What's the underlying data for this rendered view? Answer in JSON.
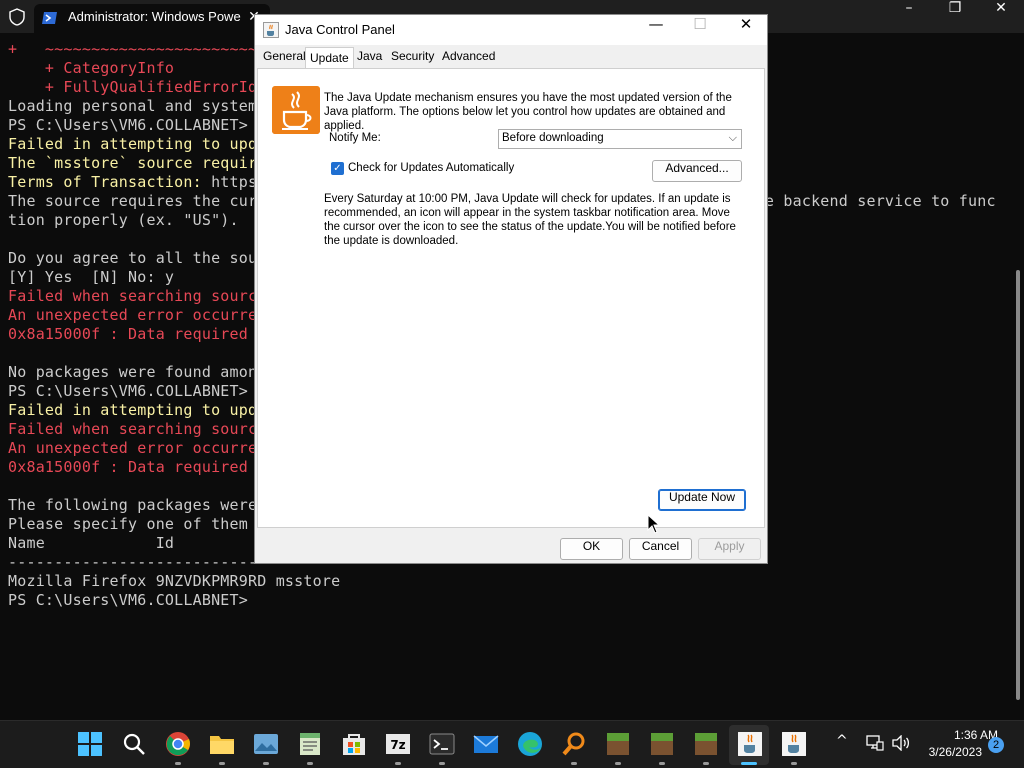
{
  "terminal": {
    "tab_title": "Administrator: Windows Powe",
    "icons": {
      "shield": "shield-icon",
      "powershell": "powershell-icon",
      "close": "close-icon"
    },
    "window_controls": {
      "minimize": "–",
      "maximize": "❐",
      "close": "✕"
    },
    "lines": [
      [
        [
          "+   ~~~~~~~~~~~~~~~~~~~~~~~~~~~~~~~~~~~~~~",
          "r"
        ]
      ],
      [
        [
          "    + CategoryInfo",
          "r"
        ]
      ],
      [
        [
          "    + FullyQualifiedErrorId",
          "r"
        ]
      ],
      [
        [
          "Loading personal and system",
          "w"
        ]
      ],
      [
        [
          "PS C:\\Users\\VM6.COLLABNET> ",
          "w"
        ],
        [
          "w",
          "y"
        ]
      ],
      [
        [
          "Failed in attempting to upda",
          "y"
        ]
      ],
      [
        [
          "The `msstore` source require",
          "y"
        ]
      ],
      [
        [
          "Terms of Transaction: ",
          "y"
        ],
        [
          "https",
          "w"
        ]
      ],
      [
        [
          "The source requires the curr                                                     he backend service to func",
          "w"
        ]
      ],
      [
        [
          "tion properly (ex. \"US\").",
          "w"
        ]
      ],
      [
        [
          "",
          "w"
        ]
      ],
      [
        [
          "Do you agree to all the sour",
          "w"
        ]
      ],
      [
        [
          "[Y] Yes  [N] No: y",
          "w"
        ]
      ],
      [
        [
          "Failed when searching source",
          "r"
        ]
      ],
      [
        [
          "An unexpected error occurred",
          "r"
        ]
      ],
      [
        [
          "0x8a15000f : Data required b",
          "r"
        ]
      ],
      [
        [
          "",
          "w"
        ]
      ],
      [
        [
          "No packages were found among",
          "w"
        ]
      ],
      [
        [
          "PS C:\\Users\\VM6.COLLABNET> ",
          "w"
        ],
        [
          "w",
          "y"
        ]
      ],
      [
        [
          "Failed in attempting to upda",
          "y"
        ]
      ],
      [
        [
          "Failed when searching source",
          "r"
        ]
      ],
      [
        [
          "An unexpected error occurred",
          "r"
        ]
      ],
      [
        [
          "0x8a15000f : Data required b",
          "r"
        ]
      ],
      [
        [
          "",
          "w"
        ]
      ],
      [
        [
          "The following packages were",
          "w"
        ]
      ],
      [
        [
          "Please specify one of them u",
          "w"
        ]
      ],
      [
        [
          "Name            Id",
          "w"
        ]
      ],
      [
        [
          "------------------------------",
          "w"
        ]
      ],
      [
        [
          "Mozilla Firefox 9NZVDKPMR9RD msstore",
          "w"
        ]
      ],
      [
        [
          "PS C:\\Users\\VM6.COLLABNET> ",
          "w"
        ]
      ]
    ]
  },
  "java_control_panel": {
    "title": "Java Control Panel",
    "title_icon": "java-cup-icon",
    "window_controls": {
      "minimize": "—",
      "maximize": "☐",
      "close": "✕"
    },
    "tabs": [
      "General",
      "Update",
      "Java",
      "Security",
      "Advanced"
    ],
    "active_tab": "Update",
    "intro_text": "The Java Update mechanism ensures you have the most updated version of the Java platform. The options below let you control how updates are obtained and applied.",
    "notify_label": "Notify Me:",
    "notify_value": "Before downloading",
    "auto_check_label": "Check for Updates Automatically",
    "auto_check_checked": true,
    "advanced_button": "Advanced...",
    "schedule_text": "Every Saturday at 10:00 PM, Java Update will check for updates. If an update is recommended, an icon will appear in the system taskbar notification area. Move the cursor over the icon to see the status of the update.You will be notified before the update is downloaded.",
    "update_now_button": "Update Now",
    "ok_button": "OK",
    "cancel_button": "Cancel",
    "apply_button": "Apply"
  },
  "taskbar": {
    "apps": [
      "start-icon",
      "search-icon",
      "chrome-icon",
      "file-explorer-icon",
      "photos-icon",
      "notepad-icon",
      "microsoft-store-icon",
      "7zip-icon",
      "terminal-icon",
      "mail-icon",
      "edge-icon",
      "search-tool-icon",
      "minecraft-icon",
      "minecraft-icon",
      "minecraft-icon",
      "java-icon",
      "java-icon"
    ],
    "tray": {
      "chevron": "^",
      "network_icon": "network-icon",
      "volume_icon": "volume-icon"
    },
    "time": "1:36 AM",
    "date": "3/26/2023",
    "notification_count": "2"
  },
  "colors": {
    "terminal_bg": "#0c0c0c",
    "error_red": "#e74856",
    "warning_yellow": "#f9f1a5",
    "text_gray": "#cccccc",
    "accent_blue": "#1f6fd1",
    "taskbar_bg": "#1c1c1c"
  }
}
